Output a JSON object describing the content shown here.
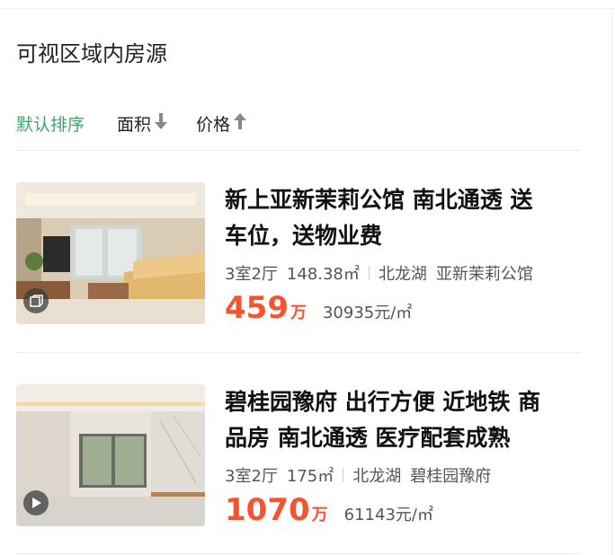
{
  "header": {
    "title": "可视区域内房源"
  },
  "sort": {
    "default_label": "默认排序",
    "area_label": "面积",
    "price_label": "价格",
    "active_color": "#3aa56c"
  },
  "listings": [
    {
      "title_line1": "新上亚新茉莉公馆 南北通透 送",
      "title_line2": "车位，送物业费",
      "layout": "3室2厅",
      "area": "148.38㎡",
      "district": "北龙湖",
      "community": "亚新茉莉公馆",
      "price": "459",
      "price_unit": "万",
      "unit_price": "30935元/㎡",
      "media_icon": "vr-cube-icon"
    },
    {
      "title_line1": "碧桂园豫府 出行方便 近地铁 商",
      "title_line2": "品房 南北通透 医疗配套成熟",
      "layout": "3室2厅",
      "area": "175㎡",
      "district": "北龙湖",
      "community": "碧桂园豫府",
      "price": "1070",
      "price_unit": "万",
      "unit_price": "61143元/㎡",
      "media_icon": "video-play-icon"
    }
  ],
  "colors": {
    "price": "#f5542f",
    "accent": "#3aa56c"
  }
}
